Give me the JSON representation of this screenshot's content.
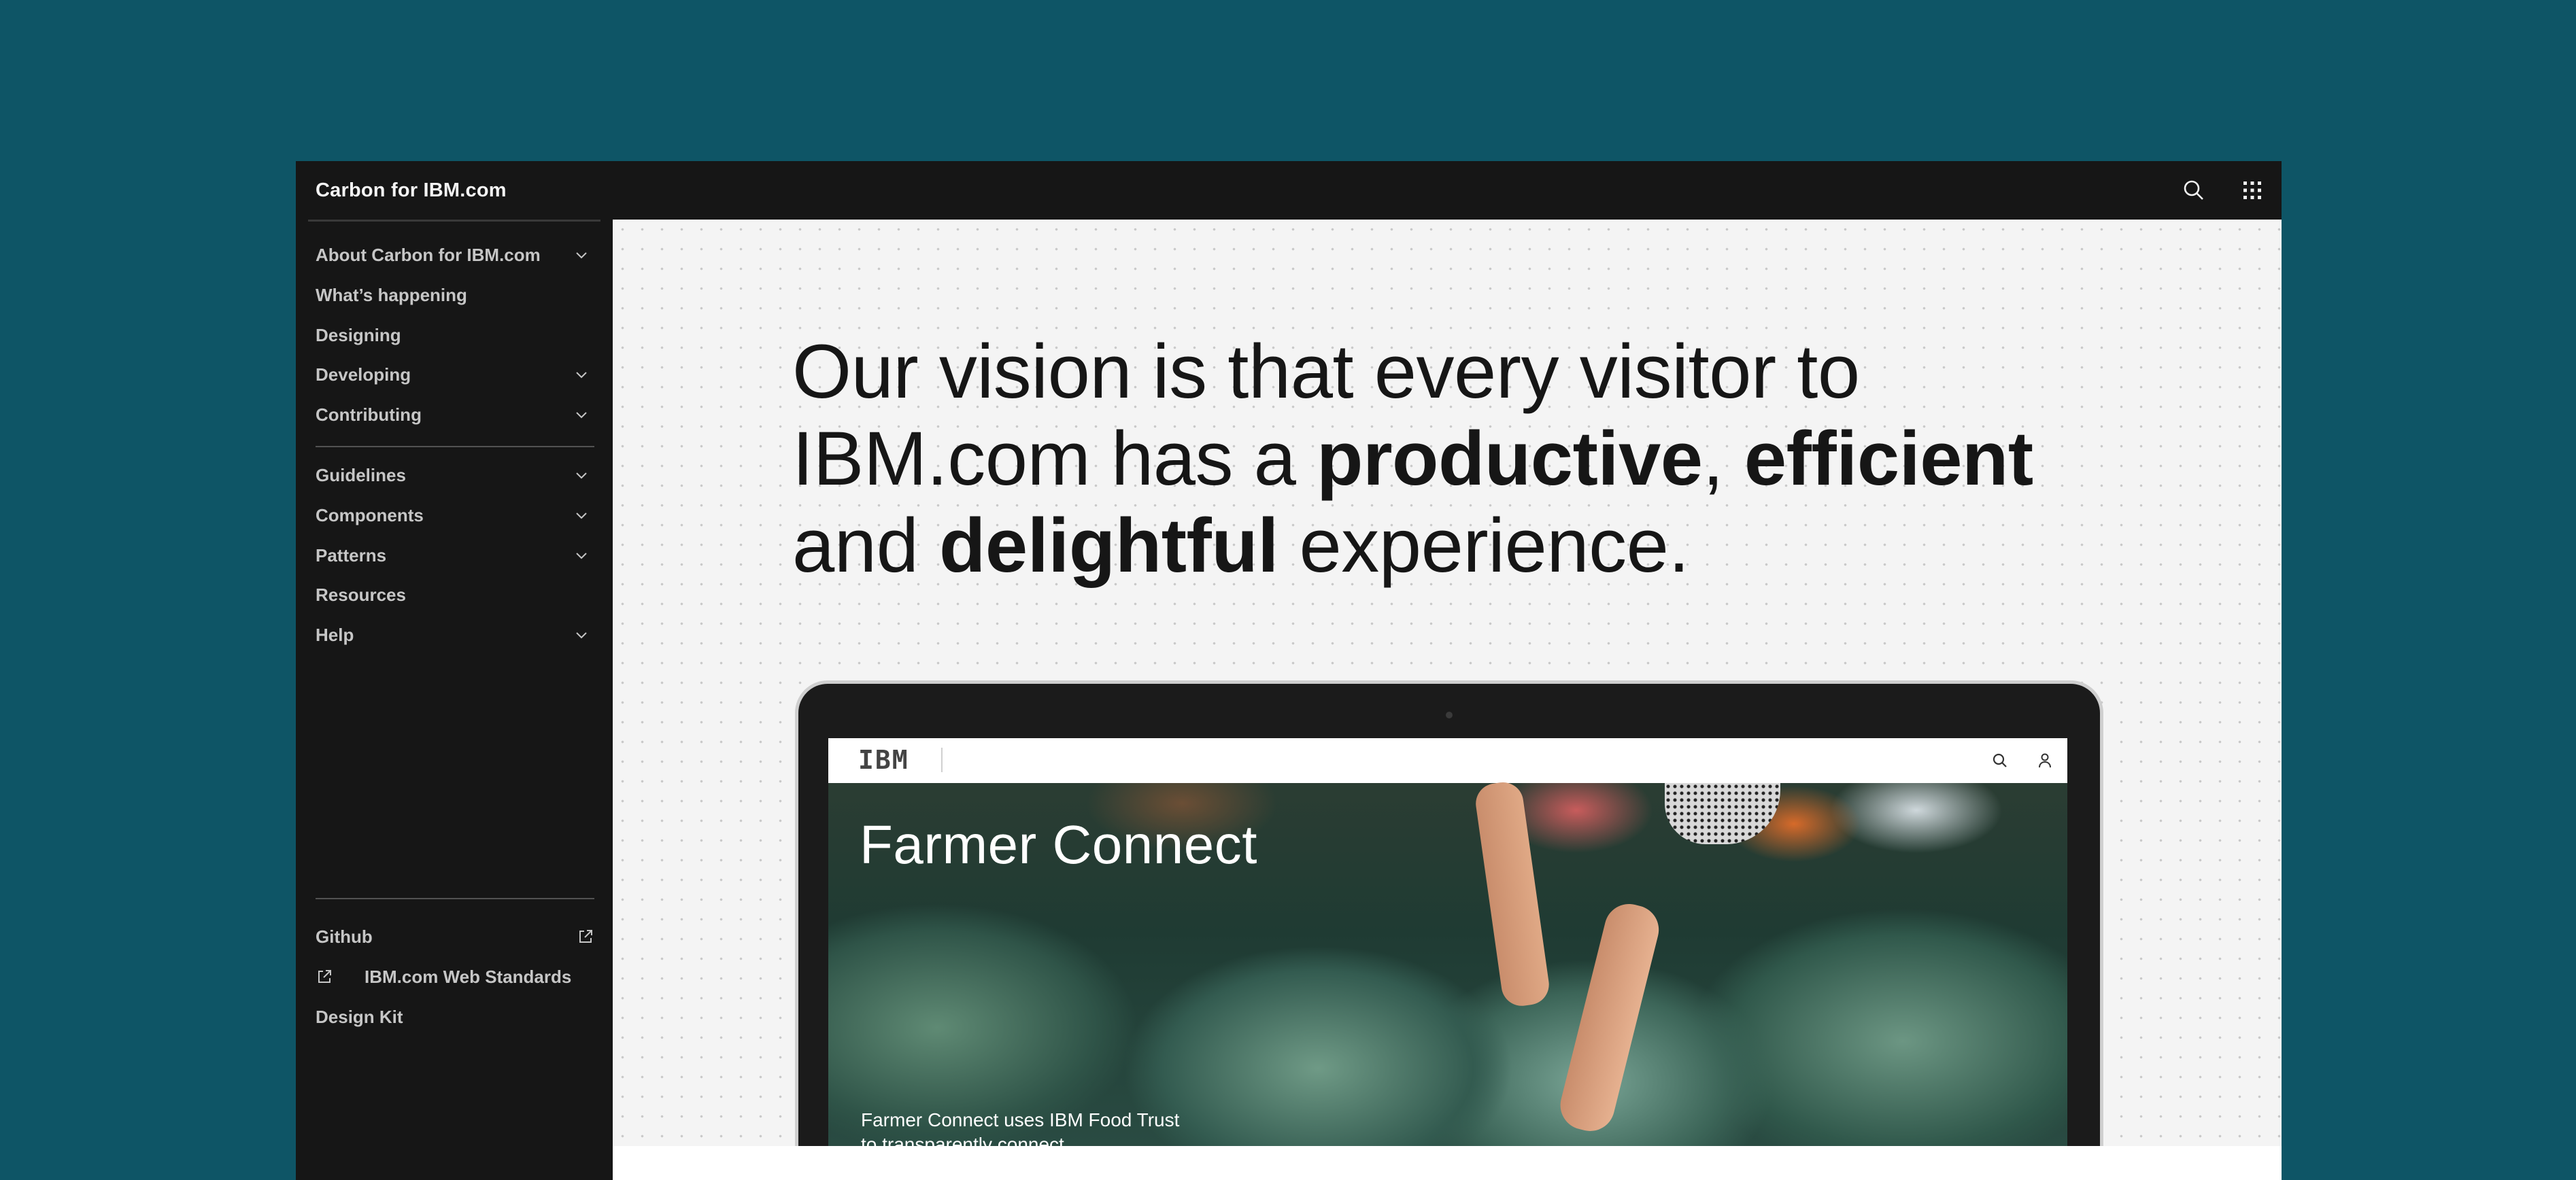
{
  "header": {
    "brand": "Carbon for IBM.com",
    "search_icon": "search-icon",
    "switcher_icon": "app-switcher-icon"
  },
  "sidebar": {
    "primary": [
      {
        "label": "About Carbon for IBM.com",
        "expandable": true
      },
      {
        "label": "What’s happening",
        "expandable": false
      },
      {
        "label": "Designing",
        "expandable": false
      },
      {
        "label": "Developing",
        "expandable": true
      },
      {
        "label": "Contributing",
        "expandable": true
      }
    ],
    "secondary": [
      {
        "label": "Guidelines",
        "expandable": true
      },
      {
        "label": "Components",
        "expandable": true
      },
      {
        "label": "Patterns",
        "expandable": true
      },
      {
        "label": "Resources",
        "expandable": false
      },
      {
        "label": "Help",
        "expandable": true
      }
    ],
    "links": [
      {
        "label": "Github",
        "icon": "launch-icon"
      },
      {
        "label": "IBM.com Web Standards",
        "icon": "launch-icon"
      },
      {
        "label": "Design Kit"
      }
    ]
  },
  "main": {
    "headline": {
      "line1": "Our vision is that every visitor to",
      "line2_pre": "IBM.com has a ",
      "line2_bold1": "productive",
      "line2_mid": ", ",
      "line2_bold2": "efficient",
      "line3_pre": "and ",
      "line3_bold": "delightful",
      "line3_post": " experience."
    },
    "laptop": {
      "logo": "IBM",
      "hero_title": "Farmer Connect",
      "hero_caption": "Farmer Connect uses IBM Food Trust to transparently connect"
    }
  },
  "colors": {
    "background": "#0e5566",
    "shell": "#161616",
    "content": "#f4f4f4"
  }
}
